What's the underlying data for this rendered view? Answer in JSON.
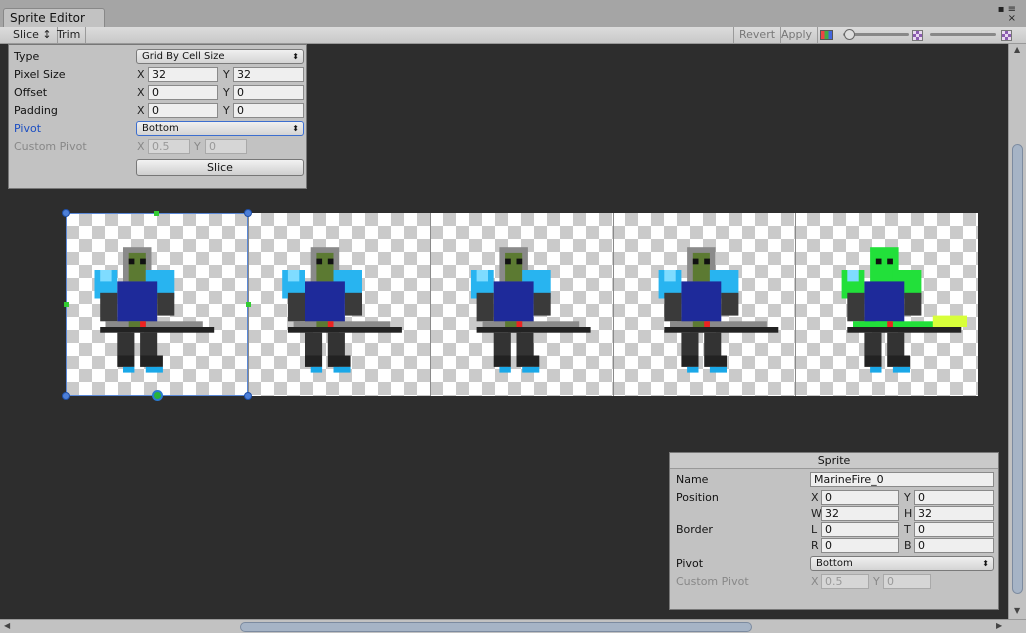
{
  "window": {
    "tab_title": "Sprite Editor",
    "controls": "▪ ≡\n×"
  },
  "toolbar": {
    "slice_label": "Slice ↕",
    "trim_label": "Trim",
    "revert_label": "Revert",
    "apply_label": "Apply"
  },
  "slice_panel": {
    "type_label": "Type",
    "type_value": "Grid By Cell Size",
    "pixel_size_label": "Pixel Size",
    "pixel_size_x": "32",
    "pixel_size_y": "32",
    "offset_label": "Offset",
    "offset_x": "0",
    "offset_y": "0",
    "padding_label": "Padding",
    "padding_x": "0",
    "padding_y": "0",
    "pivot_label": "Pivot",
    "pivot_value": "Bottom",
    "custom_pivot_label": "Custom Pivot",
    "custom_pivot_x": "0.5",
    "custom_pivot_y": "0",
    "slice_button": "Slice",
    "x_label": "X",
    "y_label": "Y"
  },
  "sprite_panel": {
    "title": "Sprite",
    "name_label": "Name",
    "name_value": "MarineFire_0",
    "position_label": "Position",
    "pos_x": "0",
    "pos_y": "0",
    "pos_w": "32",
    "pos_h": "32",
    "border_label": "Border",
    "border_l": "0",
    "border_t": "0",
    "border_r": "0",
    "border_b": "0",
    "pivot_label": "Pivot",
    "pivot_value": "Bottom",
    "custom_pivot_label": "Custom Pivot",
    "custom_pivot_x": "0.5",
    "custom_pivot_y": "0",
    "x_label": "X",
    "y_label": "Y",
    "w_label": "W",
    "h_label": "H",
    "l_label": "L",
    "t_label": "T",
    "r_label": "R",
    "b_label": "B"
  },
  "sprite_sheet": {
    "frame_count": 5,
    "selected_frame": 0
  },
  "colors": {
    "canvas_bg": "#2d2d2d",
    "panel_bg": "#c2c2c2",
    "selection": "#4d7fd8",
    "pivot_label": "#1b4ec2"
  }
}
